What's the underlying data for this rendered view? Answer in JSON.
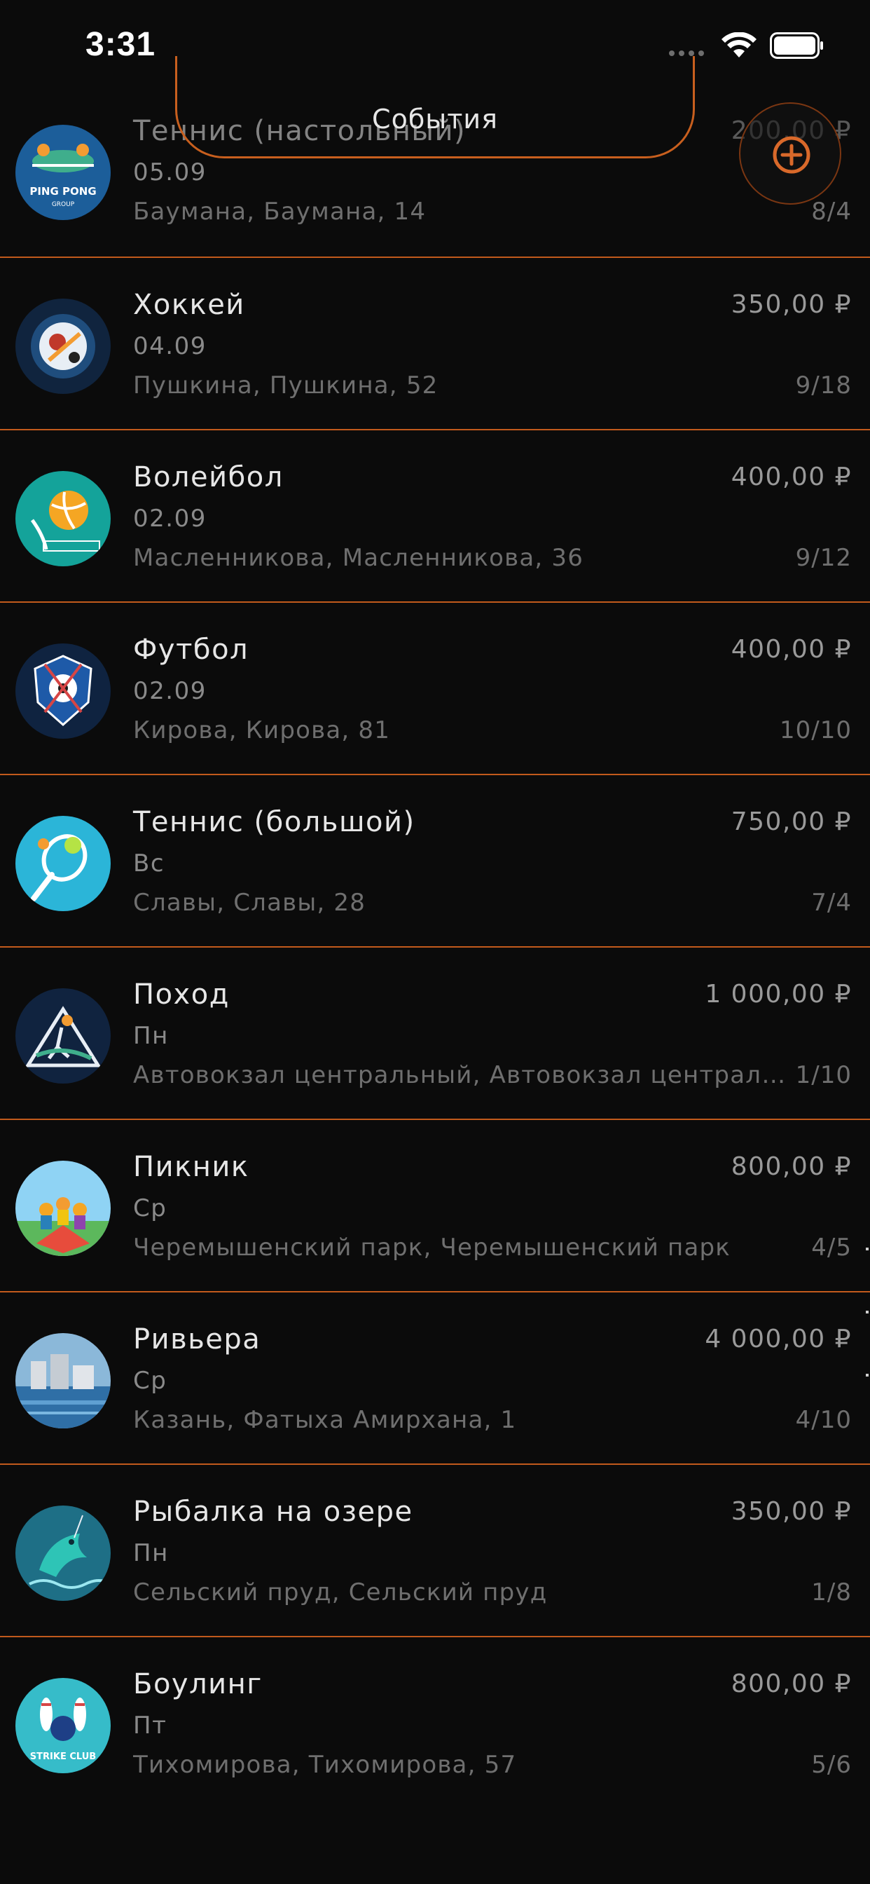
{
  "status_bar": {
    "time": "3:31"
  },
  "header": {
    "title": "События",
    "accent_color": "#c85f1e",
    "add_icon": "plus-circle-icon"
  },
  "events": [
    {
      "title": "Теннис (настольный)",
      "date": "05.09",
      "address": "Баумана, Баумана, 14",
      "price": "200,00 ₽",
      "count": "8/4",
      "logo_text": "PING PONG"
    },
    {
      "title": "Хоккей",
      "date": "04.09",
      "address": "Пушкина, Пушкина, 52",
      "price": "350,00 ₽",
      "count": "9/18"
    },
    {
      "title": "Волейбол",
      "date": "02.09",
      "address": "Масленникова, Масленникова, 36",
      "price": "400,00 ₽",
      "count": "9/12"
    },
    {
      "title": "Футбол",
      "date": "02.09",
      "address": "Кирова, Кирова, 81",
      "price": "400,00 ₽",
      "count": "10/10"
    },
    {
      "title": "Теннис (большой)",
      "date": "Вс",
      "address": "Славы, Славы, 28",
      "price": "750,00 ₽",
      "count": "7/4"
    },
    {
      "title": "Поход",
      "date": "Пн",
      "address": "Автовокзал центральный, Автовокзал центральный",
      "price": "1 000,00 ₽",
      "count": "1/10"
    },
    {
      "title": "Пикник",
      "date": "Ср",
      "address": "Черемышенский парк, Черемышенский парк",
      "price": "800,00 ₽",
      "count": "4/5"
    },
    {
      "title": "Ривьера",
      "date": "Ср",
      "address": "Казань, Фатыха Амирхана, 1",
      "price": "4 000,00 ₽",
      "count": "4/10"
    },
    {
      "title": "Рыбалка на озере",
      "date": "Пн",
      "address": "Сельский пруд, Сельский пруд",
      "price": "350,00 ₽",
      "count": "1/8"
    },
    {
      "title": "Боулинг",
      "date": "Пт",
      "address": "Тихомирова, Тихомирова, 57",
      "price": "800,00 ₽",
      "count": "5/6",
      "logo_text": "STRIKE CLUB"
    }
  ]
}
